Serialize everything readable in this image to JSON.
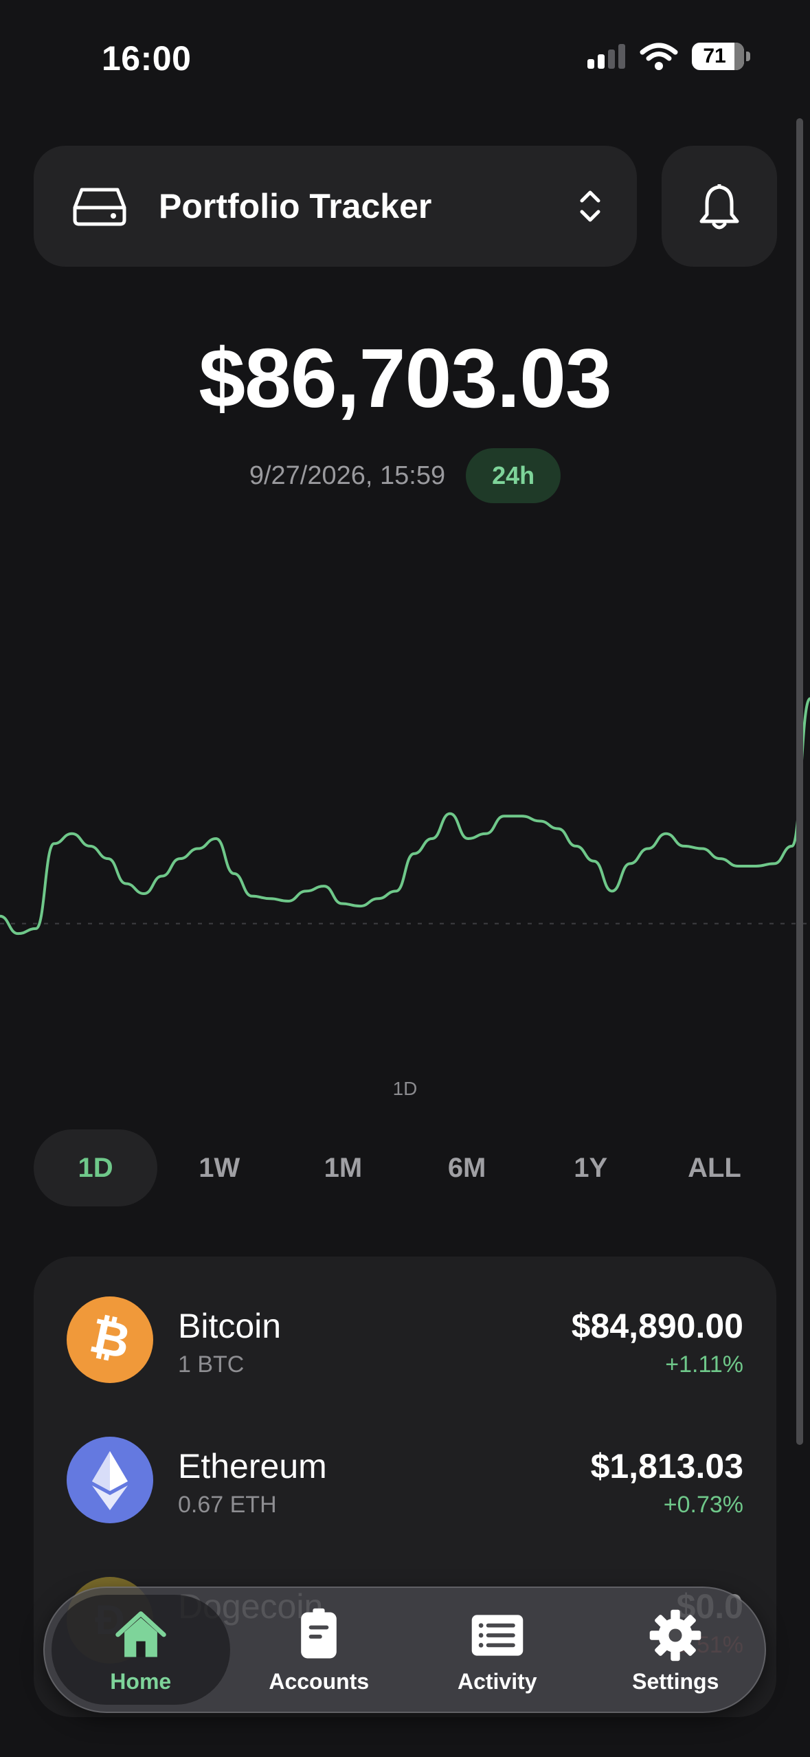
{
  "status_bar": {
    "time": "16:00",
    "battery": "71"
  },
  "header": {
    "title": "Portfolio Tracker"
  },
  "balance": {
    "total": "$86,703.03",
    "timestamp": "9/27/2026, 15:59",
    "period_badge": "24h"
  },
  "chart_data": {
    "type": "line",
    "caption": "1D",
    "baseline_value": 0,
    "series": [
      {
        "values": [
          0.3,
          -0.4,
          -0.2,
          3.2,
          3.6,
          3.1,
          2.6,
          1.6,
          1.2,
          1.9,
          2.6,
          3.0,
          3.4,
          2.0,
          1.1,
          1.0,
          0.9,
          1.3,
          1.5,
          0.8,
          0.7,
          1.0,
          1.3,
          2.8,
          3.4,
          4.4,
          3.4,
          3.6,
          4.3,
          4.3,
          4.1,
          3.8,
          3.1,
          2.5,
          1.3,
          2.4,
          3.0,
          3.6,
          3.1,
          3.0,
          2.6,
          2.3,
          2.3,
          2.4,
          3.1,
          9.0
        ]
      }
    ]
  },
  "ranges": [
    "1D",
    "1W",
    "1M",
    "6M",
    "1Y",
    "ALL"
  ],
  "active_range": "1D",
  "assets": [
    {
      "name": "Bitcoin",
      "amount": "1 BTC",
      "value": "$84,890.00",
      "change": "+1.11%",
      "color": "#f0993a",
      "icon": "bitcoin-icon"
    },
    {
      "name": "Ethereum",
      "amount": "0.67 ETH",
      "value": "$1,813.03",
      "change": "+0.73%",
      "color": "#6479e0",
      "icon": "ethereum-icon"
    },
    {
      "name": "Dogecoin",
      "amount": "",
      "value": "$0.0",
      "change": "-1.51%",
      "color": "#c2a633",
      "icon": "dogecoin-icon"
    }
  ],
  "tabbar": [
    {
      "label": "Home",
      "icon": "home-icon"
    },
    {
      "label": "Accounts",
      "icon": "accounts-icon"
    },
    {
      "label": "Activity",
      "icon": "activity-icon"
    },
    {
      "label": "Settings",
      "icon": "settings-icon"
    }
  ],
  "colors": {
    "accent": "#6fc88a",
    "background": "#141416",
    "card": "#232325",
    "negative": "#d05a5a"
  }
}
